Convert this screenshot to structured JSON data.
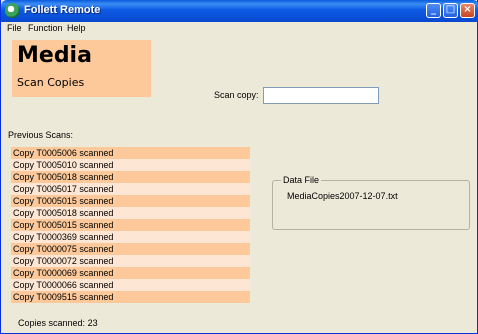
{
  "window": {
    "title": "Follett Remote"
  },
  "menu": [
    "File",
    "Function",
    "Help"
  ],
  "header": {
    "title": "Media",
    "subtitle": "Scan Copies"
  },
  "scan": {
    "label": "Scan copy:",
    "value": ""
  },
  "previous": {
    "label": "Previous Scans:",
    "items": [
      "Copy T0005006 scanned",
      "Copy T0005010 scanned",
      "Copy T0005018 scanned",
      "Copy T0005017 scanned",
      "Copy T0005015 scanned",
      "Copy T0005018 scanned",
      "Copy T0005015 scanned",
      "Copy T0000369 scanned",
      "Copy T0000075 scanned",
      "Copy T0000072 scanned",
      "Copy T0000069 scanned",
      "Copy T0000066 scanned",
      "Copy T0009515 scanned"
    ]
  },
  "data_file": {
    "legend": "Data File",
    "name": "MediaCopies2007-12-07.txt"
  },
  "status": {
    "copies_scanned_label": "Copies scanned:",
    "copies_scanned_value": "23"
  },
  "colors": {
    "title_bar": "#0a5bdc",
    "accent": "#fdc99b",
    "row_alt": "#fde6d3",
    "background": "#ece9d8"
  }
}
